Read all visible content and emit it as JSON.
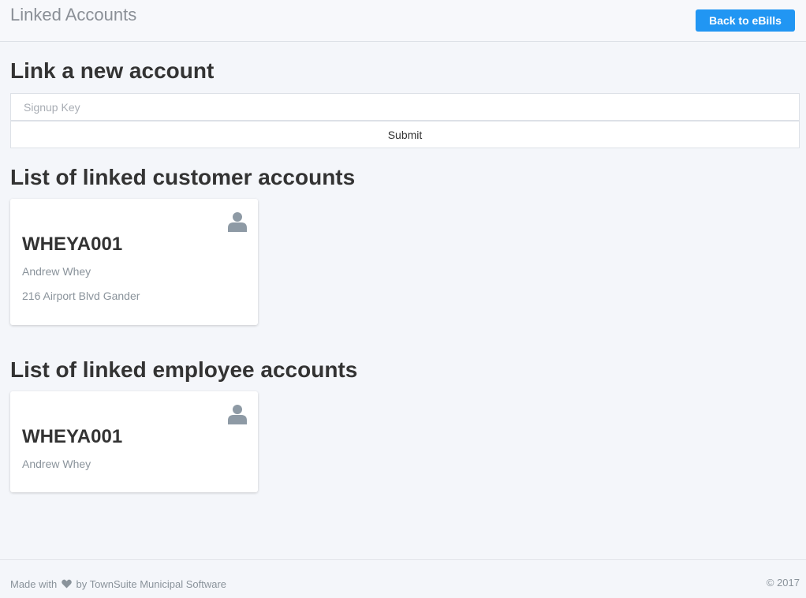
{
  "header": {
    "title": "Linked Accounts",
    "back_button_label": "Back to eBills"
  },
  "link_section": {
    "heading": "Link a new account",
    "signup_key_placeholder": "Signup Key",
    "signup_key_value": "",
    "submit_label": "Submit"
  },
  "customer_section": {
    "heading": "List of linked customer accounts",
    "accounts": [
      {
        "id": "WHEYA001",
        "name": "Andrew Whey",
        "address": "216 Airport Blvd Gander",
        "icon": "user-icon"
      }
    ]
  },
  "employee_section": {
    "heading": "List of linked employee accounts",
    "accounts": [
      {
        "id": "WHEYA001",
        "name": "Andrew Whey",
        "icon": "user-icon"
      }
    ]
  },
  "footer": {
    "made_with_prefix": "Made with",
    "heart_icon": "heart-icon",
    "made_with_suffix": "by TownSuite Municipal Software",
    "copyright": "© 2017"
  },
  "colors": {
    "accent": "#2196f3",
    "background": "#f4f6fa",
    "muted_text": "#8a939b",
    "icon": "#8e9aa5"
  }
}
